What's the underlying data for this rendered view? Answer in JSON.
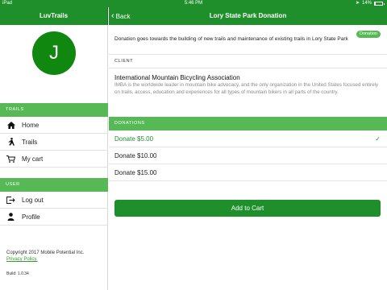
{
  "status_bar": {
    "carrier": "iPad",
    "time": "5:46 PM",
    "battery": "14%"
  },
  "sidebar": {
    "title": "LuvTrails",
    "avatar_initial": "J",
    "trails_section": "TRAILS",
    "trails_items": [
      {
        "label": "Home",
        "icon": "home-icon"
      },
      {
        "label": "Trails",
        "icon": "hiker-icon"
      },
      {
        "label": "My cart",
        "icon": "cart-icon"
      }
    ],
    "user_section": "USER",
    "user_items": [
      {
        "label": "Log out",
        "icon": "logout-icon"
      },
      {
        "label": "Profile",
        "icon": "person-icon"
      }
    ],
    "copyright": "Copyright 2017 Mobile Potential Inc.",
    "privacy": "Privacy Policy.",
    "build": "Build: 1.0.34"
  },
  "main": {
    "back_label": "Back",
    "title": "Lory State Park Donation",
    "description": "Donation goes towards the building of new trails and maintenance of existing trails in Lory State Park",
    "badge": "Donation",
    "client_label": "CLIENT",
    "client_name": "International Mountain Bicycling Association",
    "client_desc": "IMBA is the worldwide leader in mountain bike advocacy, and the only organization in the United States focused entirely on trails, access, education and experiences for all types of mountain bikers in all parts of the country.",
    "donations_label": "DONATIONS",
    "donations": [
      {
        "label": "Donate $5.00",
        "selected": true
      },
      {
        "label": "Donate $10.00",
        "selected": false
      },
      {
        "label": "Donate $15.00",
        "selected": false
      }
    ],
    "add_to_cart": "Add to Cart"
  },
  "colors": {
    "brand": "#1e8f2b",
    "section": "#56b956",
    "avatar": "#10870f"
  }
}
